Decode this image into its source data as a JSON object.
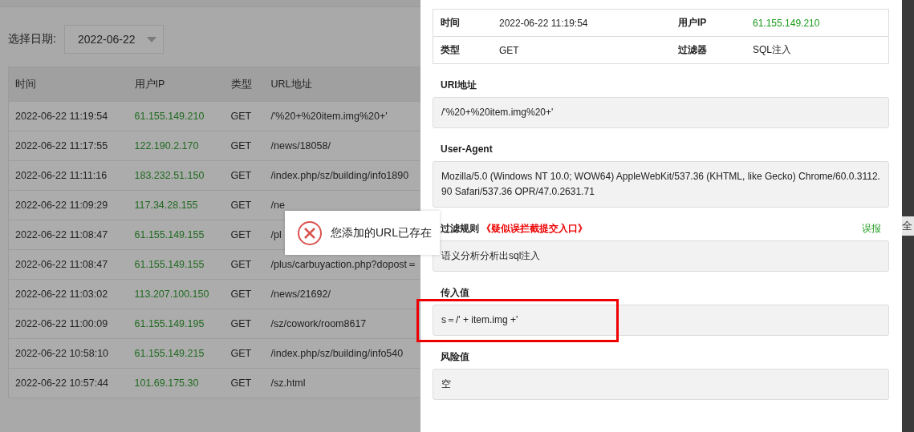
{
  "filter": {
    "label": "选择日期:",
    "date": "2022-06-22"
  },
  "table": {
    "columns": [
      "时间",
      "用户IP",
      "类型",
      "URL地址"
    ],
    "rows": [
      {
        "time": "2022-06-22 11:19:54",
        "ip": "61.155.149.210",
        "type": "GET",
        "url": "/'%20+%20item.img%20+'"
      },
      {
        "time": "2022-06-22 11:17:55",
        "ip": "122.190.2.170",
        "type": "GET",
        "url": "/news/18058/"
      },
      {
        "time": "2022-06-22 11:11:16",
        "ip": "183.232.51.150",
        "type": "GET",
        "url": "/index.php/sz/building/info1890"
      },
      {
        "time": "2022-06-22 11:09:29",
        "ip": "117.34.28.155",
        "type": "GET",
        "url": "/ne"
      },
      {
        "time": "2022-06-22 11:08:47",
        "ip": "61.155.149.155",
        "type": "GET",
        "url": "/pl"
      },
      {
        "time": "2022-06-22 11:08:47",
        "ip": "61.155.149.155",
        "type": "GET",
        "url": "/plus/carbuyaction.php?dopost＝"
      },
      {
        "time": "2022-06-22 11:03:02",
        "ip": "113.207.100.150",
        "type": "GET",
        "url": "/news/21692/"
      },
      {
        "time": "2022-06-22 11:00:09",
        "ip": "61.155.149.195",
        "type": "GET",
        "url": "/sz/cowork/room8617"
      },
      {
        "time": "2022-06-22 10:58:10",
        "ip": "61.155.149.215",
        "type": "GET",
        "url": "/index.php/sz/building/info540"
      },
      {
        "time": "2022-06-22 10:57:44",
        "ip": "101.69.175.30",
        "type": "GET",
        "url": "/sz.html"
      }
    ]
  },
  "detail": {
    "info": [
      {
        "label": "时间",
        "value": "2022-06-22 11:19:54",
        "label2": "用户IP",
        "value2": "61.155.149.210"
      },
      {
        "label": "类型",
        "value": "GET",
        "label2": "过滤器",
        "value2": "SQL注入"
      }
    ],
    "sections": [
      {
        "title": "URI地址",
        "value": "/'%20+%20item.img%20+'",
        "highlighted": false
      },
      {
        "title": "User-Agent",
        "value": "Mozilla/5.0 (Windows NT 10.0; WOW64) AppleWebKit/537.36 (KHTML, like Gecko) Chrome/60.0.3112.90 Safari/537.36 OPR/47.0.2631.71",
        "highlighted": false
      },
      {
        "title": "过滤规则",
        "tag": "《疑似误拦截提交入口》",
        "action": "误报",
        "value": "语义分析分析出sql注入",
        "highlighted": false
      },
      {
        "title": "传入值",
        "value": "s＝/' + item.img +'",
        "highlighted": true
      },
      {
        "title": "风险值",
        "value": "空",
        "highlighted": false
      }
    ]
  },
  "side_text": "全",
  "toast": {
    "message": "您添加的URL已存在"
  }
}
